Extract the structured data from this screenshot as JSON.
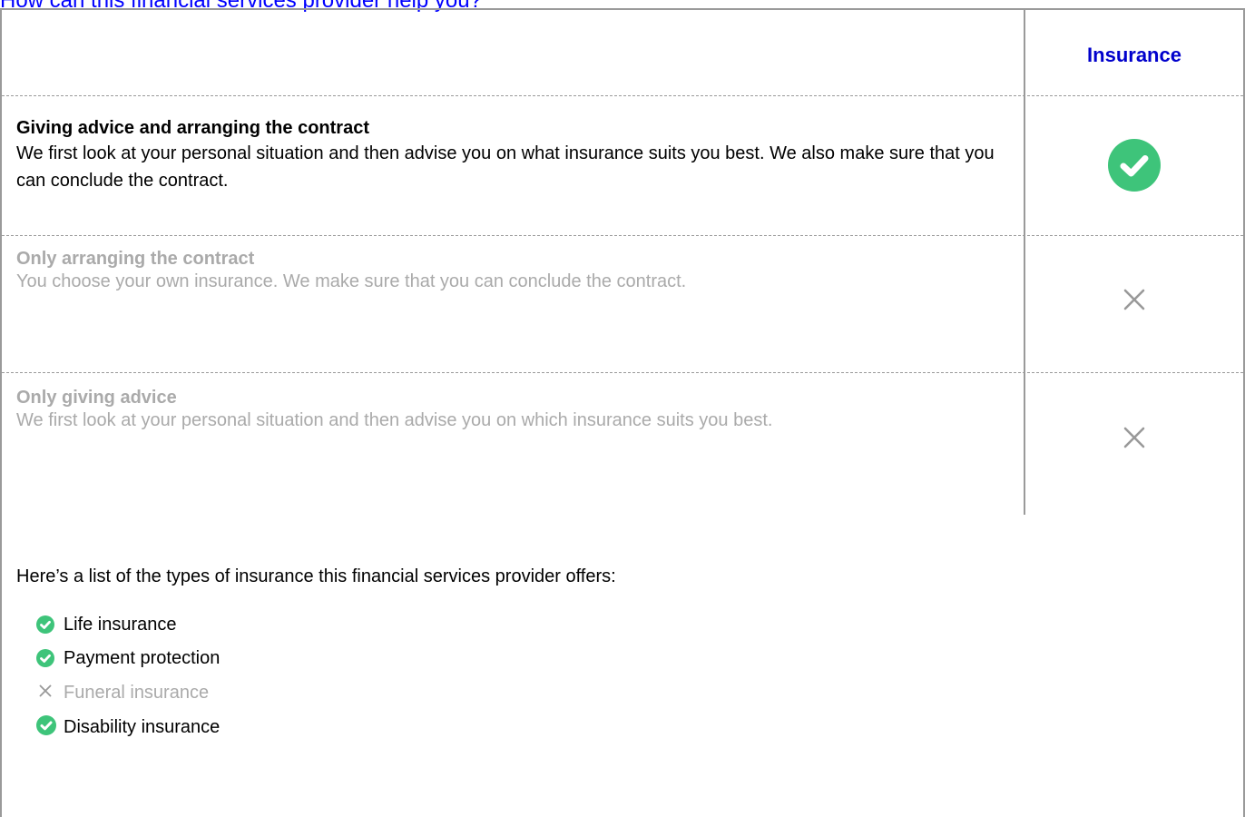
{
  "heading": "How can this financial services provider help you?",
  "column_header": "Insurance",
  "colors": {
    "heading": "#0000ff",
    "column_header": "#0000cc",
    "check": "#3ec47a",
    "cross": "#999999",
    "inactive_text": "#aaaaaa",
    "rule": "#9a9a9a"
  },
  "services": [
    {
      "title": "Giving advice and arranging the contract",
      "description": "We first look at your personal situation and then advise you on what insurance suits you best. We also make sure that you can conclude the contract.",
      "offered": true,
      "icon": "check-circle-icon"
    },
    {
      "title": "Only arranging the contract",
      "description": "You choose your own insurance. We make sure that you can conclude the contract.",
      "offered": false,
      "icon": "cross-icon"
    },
    {
      "title": "Only giving advice",
      "description": "We first look at your personal situation and then advise you on which insurance suits you best.",
      "offered": false,
      "icon": "cross-icon"
    }
  ],
  "list_intro": "Here’s a list of the types of insurance this financial services provider offers:",
  "insurance_types": [
    {
      "label": "Life insurance",
      "offered": true,
      "icon": "check-circle-icon"
    },
    {
      "label": "Payment protection",
      "offered": true,
      "icon": "check-circle-icon"
    },
    {
      "label": "Funeral insurance",
      "offered": false,
      "icon": "cross-icon"
    },
    {
      "label": "Disability insurance",
      "offered": true,
      "icon": "check-circle-icon"
    }
  ]
}
